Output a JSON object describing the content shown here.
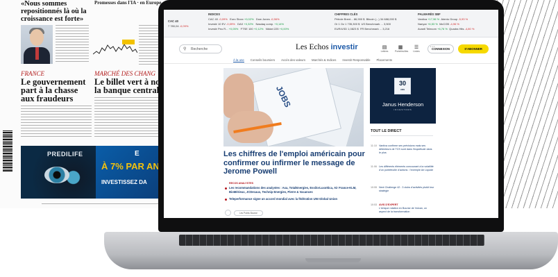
{
  "newspaper": {
    "top_headline": "«Nous sommes repositionnés là où la croissance est forte»",
    "top_headline_2": "Promesses dans l'IA · en Europe",
    "article1": {
      "category": "FRANCE",
      "title": "Le gouvernement part à la chasse aux fraudeurs"
    },
    "article2": {
      "category": "MARCHÉ DES CHANG",
      "title": "Le billet vert à nor la banque centrale"
    },
    "ad1_brand": "PREDILIFE",
    "ad2_line1": "E",
    "ad2_line2": "À 7% PAR AN",
    "ad2_line3": "INVESTISSEZ DA"
  },
  "ticker": {
    "main": {
      "name": "CAC 40",
      "value": "7 780,04",
      "change": "-0,09%"
    },
    "indices": {
      "header": "INDICES",
      "rows": [
        [
          "CAC 40",
          "-0,09%",
          "Euro Stoxx",
          "+0,02%",
          "Dow Jones",
          "-0,56%"
        ],
        [
          "Investir 10 EV",
          "-0,09%",
          "DAX",
          "+0,32%",
          "Nasdaq comp.",
          "+0,14%"
        ],
        [
          "Investir Peu R...",
          "+0,05%",
          "FTSE 100",
          "+0,12%",
          "Nikkei 225",
          "+0,00%"
        ]
      ]
    },
    "figures": {
      "header": "CHIFFRES CLÉS",
      "rows": [
        [
          "Pétrole Brent...",
          "86,900 $",
          "Bitcoin (...)",
          "34 688,000 $"
        ],
        [
          "Or 1 Oz",
          "1 735,300 $",
          "US Benchmark ...",
          "3,500"
        ],
        [
          "EUR/USD",
          "1,0823 $",
          "FR Benchmark ...",
          "3,216"
        ]
      ]
    },
    "winners": {
      "header": "PALMARÈS SBF",
      "rows": [
        [
          "Vantiva",
          "+17,96 %",
          "Atento Group",
          "-5,93 %"
        ],
        [
          "Nanyar",
          "+6,53 %",
          "McCOB",
          "-4,96 %"
        ],
        [
          "Avanti Telecom",
          "+6,76 %",
          "Quadra Hits",
          "-4,80 %"
        ]
      ]
    }
  },
  "header": {
    "search_placeholder": "Recherche",
    "logo_main": "Les Echos",
    "logo_accent": "investir",
    "tools": [
      "Lettres",
      "Portefeuilles",
      "Listes"
    ],
    "more": "···",
    "connect_label": "CONNEXION",
    "subscribe_label": "S'ABONNER"
  },
  "nav": [
    "À la une",
    "Conseils boursiers",
    "Accès des valeurs",
    "Marchés & Indices",
    "Investir Responsable",
    "Placements"
  ],
  "article": {
    "hero_text": "JOBS",
    "title": "Les chiffres de l'emploi américain pour confirmer ou infirmer le message de Jerome Powell",
    "kicker": "RECOS ANALYSTES",
    "sub1": "Les recommandations des analystes : Axa, TotalEnergies, EssilorLuxottica, Air France-KLM, BioMérieux, JCDecaux, Technip Energies, Pierre & Vacances",
    "sub2": "Teleperformance signe un accord mondial avec la fédération UNI Global Union",
    "share_label": "Les Points Bourse"
  },
  "ad": {
    "years": "30",
    "years_label": "ANS",
    "brand": "Janus Henderson",
    "brand_sub": "INVESTORS"
  },
  "direct": {
    "header": "TOUT LE DIRECT",
    "items": [
      {
        "time": "11:10",
        "text": "Vantiva confirme ses prévisions mais ses détenteurs de TCS sont dans l'inquiétude dans le plus",
        "tag": ""
      },
      {
        "time": "11:06",
        "text": "Les différents éléments concourant à la volatilité d'un portefeuille d'actions : l'exemple Air Liquide",
        "tag": ""
      },
      {
        "time": "10:55",
        "text": "Next Challenge 42 : 3 clubs d'activités plutôt leur stratégie",
        "tag": ""
      },
      {
        "time": "10:53",
        "text": "L'Unique rotation en Bourse de Volcan, un aspect de la transformation",
        "tag": "AVIS D'EXPERT"
      }
    ]
  },
  "colors": {
    "brand_blue": "#1d5aa8",
    "title_navy": "#173d72",
    "subscribe_yellow": "#f6d900",
    "alert_red": "#b5181f"
  }
}
